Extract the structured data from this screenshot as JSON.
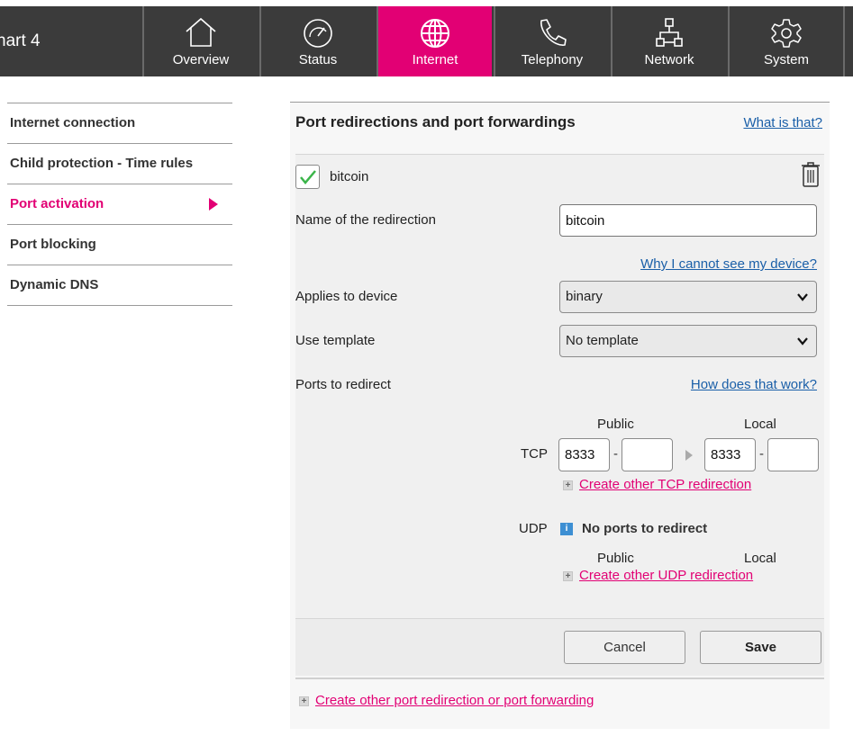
{
  "brand": {
    "title": "nart 4"
  },
  "nav": {
    "tabs": [
      {
        "label": "Overview",
        "icon": "house-icon"
      },
      {
        "label": "Status",
        "icon": "gauge-icon"
      },
      {
        "label": "Internet",
        "icon": "globe-icon"
      },
      {
        "label": "Telephony",
        "icon": "phone-icon"
      },
      {
        "label": "Network",
        "icon": "network-icon"
      },
      {
        "label": "System",
        "icon": "gear-icon"
      }
    ],
    "active": "Internet"
  },
  "sidebar": {
    "items": [
      {
        "label": "Internet connection"
      },
      {
        "label": "Child protection - Time rules"
      },
      {
        "label": "Port activation"
      },
      {
        "label": "Port blocking"
      },
      {
        "label": "Dynamic DNS"
      }
    ],
    "active": "Port activation"
  },
  "panel": {
    "title": "Port redirections and port forwardings",
    "help_link": "What is that?",
    "entry": {
      "name": "bitcoin",
      "enabled": true,
      "name_label": "Name of the redirection",
      "name_value": "bitcoin",
      "why_link": "Why I cannot see my device?",
      "device_label": "Applies to device",
      "device_value": "binary",
      "template_label": "Use template",
      "template_value": "No template",
      "ports_label": "Ports to redirect",
      "how_link": "How does that work?",
      "public_header": "Public",
      "local_header": "Local",
      "tcp": {
        "label": "TCP",
        "public_from": "8333",
        "public_to": "",
        "local_from": "8333",
        "local_to": "",
        "dash": "-",
        "add_link": "Create other TCP redirection"
      },
      "udp": {
        "label": "UDP",
        "info": "i",
        "no_ports": "No ports to redirect",
        "add_link": "Create other UDP redirection"
      }
    },
    "cancel_label": "Cancel",
    "save_label": "Save",
    "add_rule_link": "Create other port redirection or port forwarding"
  },
  "colors": {
    "accent": "#e20074",
    "topbar": "#3b3b3b",
    "link": "#1a5fa8"
  }
}
